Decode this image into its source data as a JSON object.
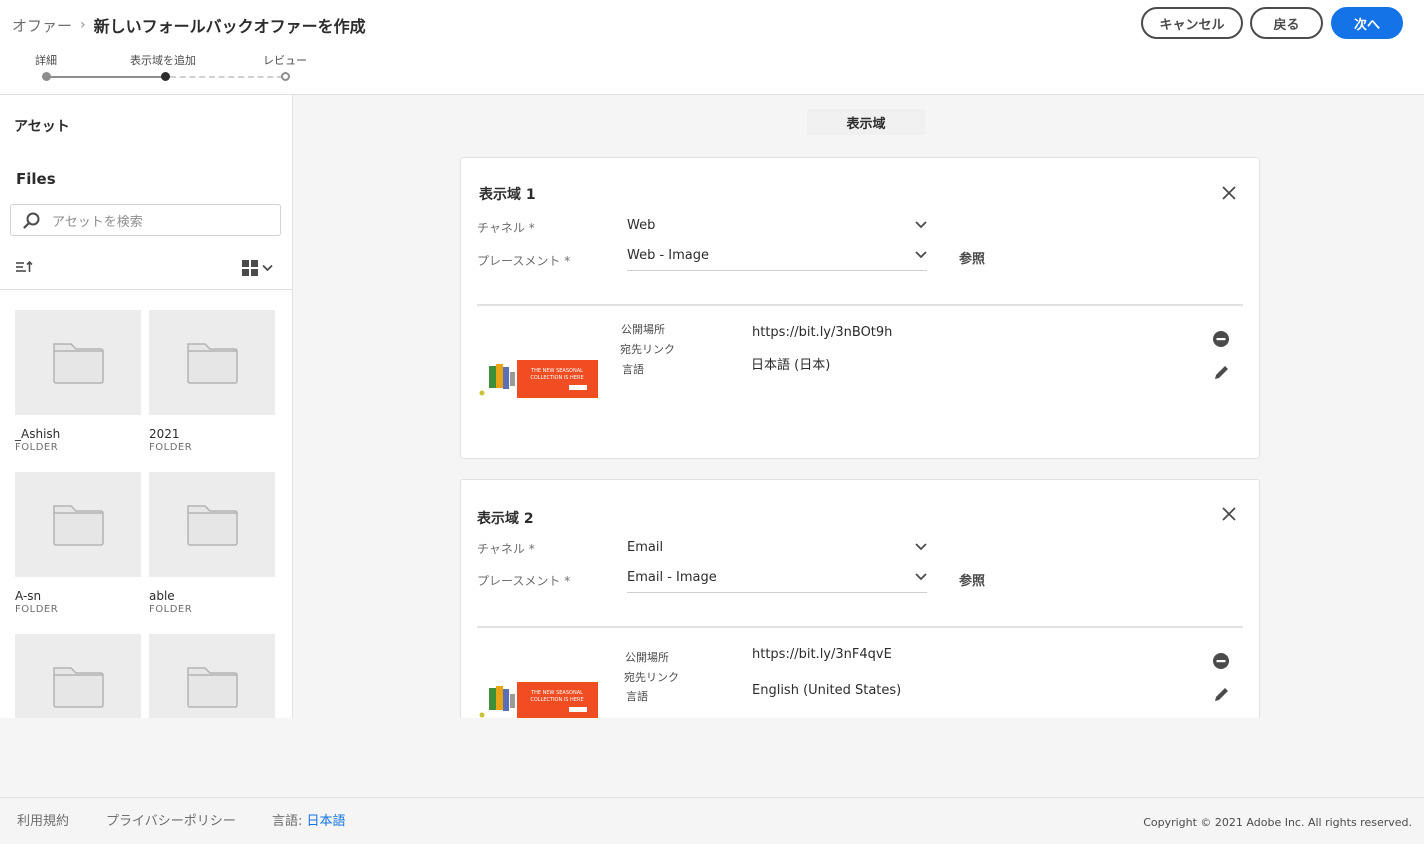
{
  "header": {
    "breadcrumb_parent": "オファー",
    "breadcrumb_separator": "›",
    "page_title": "新しいフォールバックオファーを作成",
    "cancel_label": "キャンセル",
    "back_label": "戻る",
    "next_label": "次へ",
    "primary_color": "#1473e6"
  },
  "steps": [
    {
      "label": "詳細",
      "state": "complete"
    },
    {
      "label": "表示域を追加",
      "state": "current"
    },
    {
      "label": "レビュー",
      "state": "upcoming"
    }
  ],
  "sidebar": {
    "title": "アセット",
    "files_title": "Files",
    "search_placeholder": "アセットを検索",
    "sort_icon": "sort-icon",
    "view_icon": "grid-view-icon",
    "tiles": [
      {
        "name": "_Ashish",
        "type": "FOLDER"
      },
      {
        "name": "2021",
        "type": "FOLDER"
      },
      {
        "name": "A-sn",
        "type": "FOLDER"
      },
      {
        "name": "able",
        "type": "FOLDER"
      },
      {
        "name": "",
        "type": ""
      },
      {
        "name": "",
        "type": ""
      }
    ]
  },
  "main": {
    "title": "表示域",
    "cards": [
      {
        "title": "表示域 1",
        "channel_label": "チャネル",
        "channel_value": "Web",
        "placement_label": "プレースメント",
        "placement_value": "Web - Image",
        "browse_label": "参照",
        "published_label": "公開場所",
        "link_label": "宛先リンク",
        "language_label": "言語",
        "published_value": "https://bit.ly/3nBOt9h",
        "language_value": "日本語 (日本)",
        "banner_text": "THE NEW SEASONAL COLLECTION IS HERE"
      },
      {
        "title": "表示域 2",
        "channel_label": "チャネル",
        "channel_value": "Email",
        "placement_label": "プレースメント",
        "placement_value": "Email - Image",
        "browse_label": "参照",
        "published_label": "公開場所",
        "link_label": "宛先リンク",
        "language_label": "言語",
        "published_value": "https://bit.ly/3nF4qvE",
        "language_value": "English (United States)",
        "banner_text": "THE NEW SEASONAL COLLECTION IS HERE"
      }
    ]
  },
  "footer": {
    "terms": "利用規約",
    "privacy": "プライバシーポリシー",
    "language_label": "言語:",
    "language_value": "日本語",
    "copyright": "Copyright © 2021 Adobe Inc. All rights reserved."
  }
}
